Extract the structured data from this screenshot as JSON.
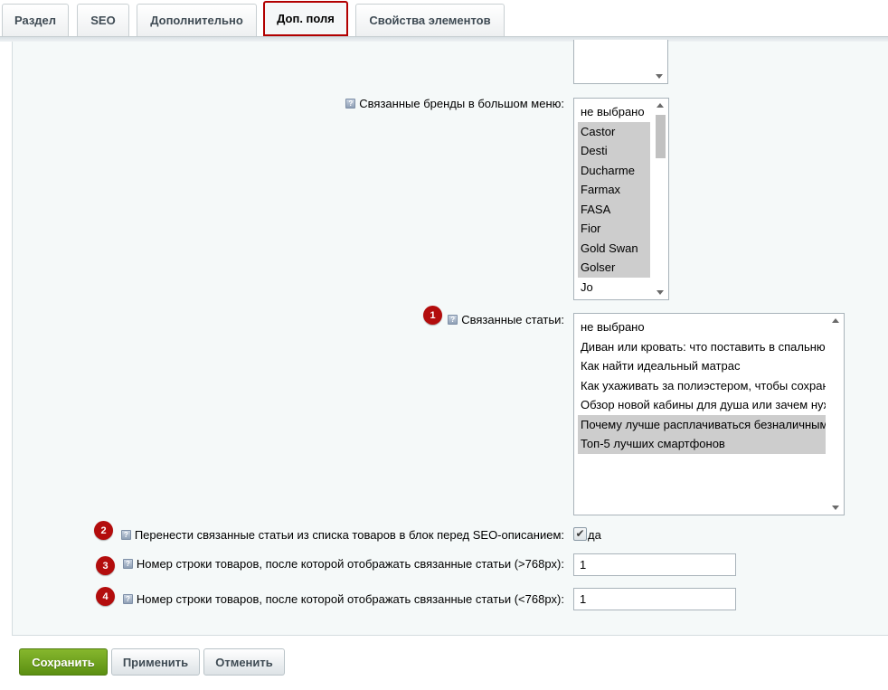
{
  "tabs": [
    {
      "label": "Раздел"
    },
    {
      "label": "SEO"
    },
    {
      "label": "Дополнительно"
    },
    {
      "label": "Доп. поля"
    },
    {
      "label": "Свойства элементов"
    }
  ],
  "fields": {
    "brands": {
      "label": "Связанные бренды в большом меню:",
      "options": [
        {
          "text": "не выбрано",
          "selected": false
        },
        {
          "text": "Castor",
          "selected": true
        },
        {
          "text": "Desti",
          "selected": true
        },
        {
          "text": "Ducharme",
          "selected": true
        },
        {
          "text": "Farmax",
          "selected": true
        },
        {
          "text": "FASA",
          "selected": true
        },
        {
          "text": "Fior",
          "selected": true
        },
        {
          "text": "Gold Swan",
          "selected": true
        },
        {
          "text": "Golser",
          "selected": true
        },
        {
          "text": "Jo",
          "selected": false
        }
      ]
    },
    "articles": {
      "badge": "1",
      "label": "Связанные статьи:",
      "options": [
        {
          "text": "не выбрано",
          "selected": false
        },
        {
          "text": "Диван или кровать: что поставить в спальню",
          "selected": false
        },
        {
          "text": "Как найти идеальный матрас",
          "selected": false
        },
        {
          "text": "Как ухаживать за полиэстером, чтобы сохранить",
          "selected": false
        },
        {
          "text": "Обзор новой кабины для душа или зачем нужен",
          "selected": false
        },
        {
          "text": "Почему лучше расплачиваться безналичными",
          "selected": true
        },
        {
          "text": "Топ-5 лучших смартфонов",
          "selected": true
        }
      ]
    },
    "move_articles": {
      "badge": "2",
      "label": "Перенести связанные статьи из списка товаров в блок перед SEO-описанием:",
      "checkbox_label": "да",
      "checked": true
    },
    "row_desktop": {
      "badge": "3",
      "label": "Номер строки товаров, после которой отображать связанные статьи (>768px):",
      "value": "1"
    },
    "row_mobile": {
      "badge": "4",
      "label": "Номер строки товаров, после которой отображать связанные статьи (<768px):",
      "value": "1"
    }
  },
  "buttons": {
    "save": "Сохранить",
    "apply": "Применить",
    "cancel": "Отменить"
  },
  "icons": {
    "help": "help-icon",
    "check": "check-icon"
  }
}
